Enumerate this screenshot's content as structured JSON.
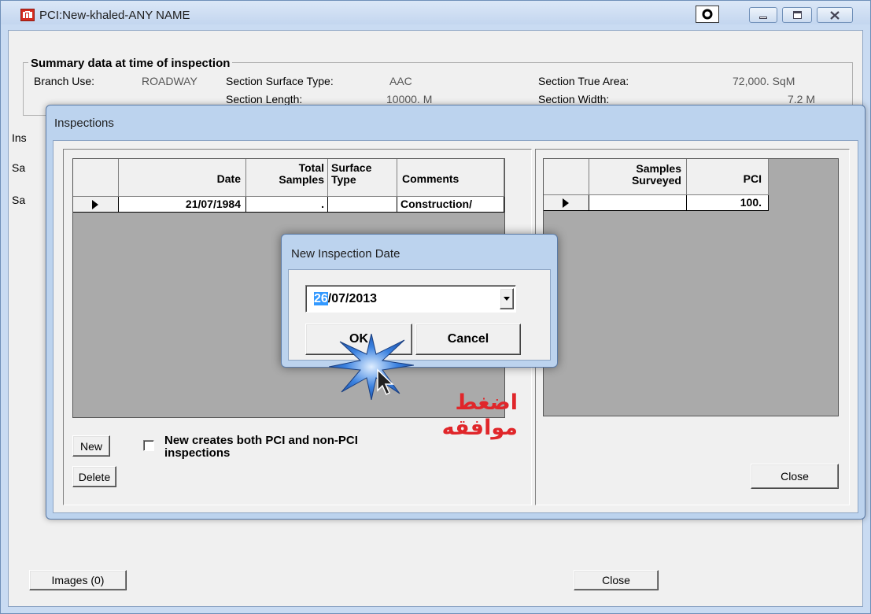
{
  "main_window": {
    "title": "PCI:New-khaled-ANY NAME",
    "title_icon": "pavement-app-icon",
    "controls": [
      "target-icon",
      "minimize-icon",
      "maximize-icon",
      "close-icon"
    ],
    "summary_group": {
      "legend": "Summary data at time of inspection",
      "branch_use_label": "Branch Use:",
      "branch_use_value": "ROADWAY",
      "surface_type_label": "Section Surface Type:",
      "surface_type_value": "AAC",
      "true_area_label": "Section True Area:",
      "true_area_value": "72,000. SqM",
      "length_label": "Section Length:",
      "length_value": "10000. M",
      "width_label": "Section Width:",
      "width_value": "7.2 M"
    },
    "left_labels": [
      "Ins",
      "Sa",
      "Sa"
    ],
    "images_button": "Images (0)",
    "close_button": "Close"
  },
  "inspections_dialog": {
    "title": "Inspections",
    "left_grid": {
      "headers": {
        "date": "Date",
        "total_samples_1": "Total",
        "total_samples_2": "Samples",
        "surface_type_1": "Surface",
        "surface_type_2": "Type",
        "comments": "Comments"
      },
      "rows": [
        {
          "date": "21/07/1984",
          "total_samples": ".",
          "surface_type": "",
          "comments": "Construction/"
        }
      ]
    },
    "right_grid": {
      "headers": {
        "samples_surveyed_1": "Samples",
        "samples_surveyed_2": "Surveyed",
        "pci": "PCI"
      },
      "rows": [
        {
          "samples_surveyed": "",
          "pci": "100."
        }
      ]
    },
    "new_button": "New",
    "delete_button": "Delete",
    "checkbox_label_1": "New creates both PCI and non-PCI",
    "checkbox_label_2": "inspections",
    "checkbox_checked": false,
    "close_button": "Close"
  },
  "new_date_dialog": {
    "title": "New Inspection Date",
    "date_selected_part": "26",
    "date_rest": "/07/2013",
    "ok_button": "OK",
    "cancel_button": "Cancel"
  },
  "annotation": {
    "arabic_text": "اضغط موافقه",
    "color": "#e0262a",
    "burst_color": "#3b82e0"
  }
}
